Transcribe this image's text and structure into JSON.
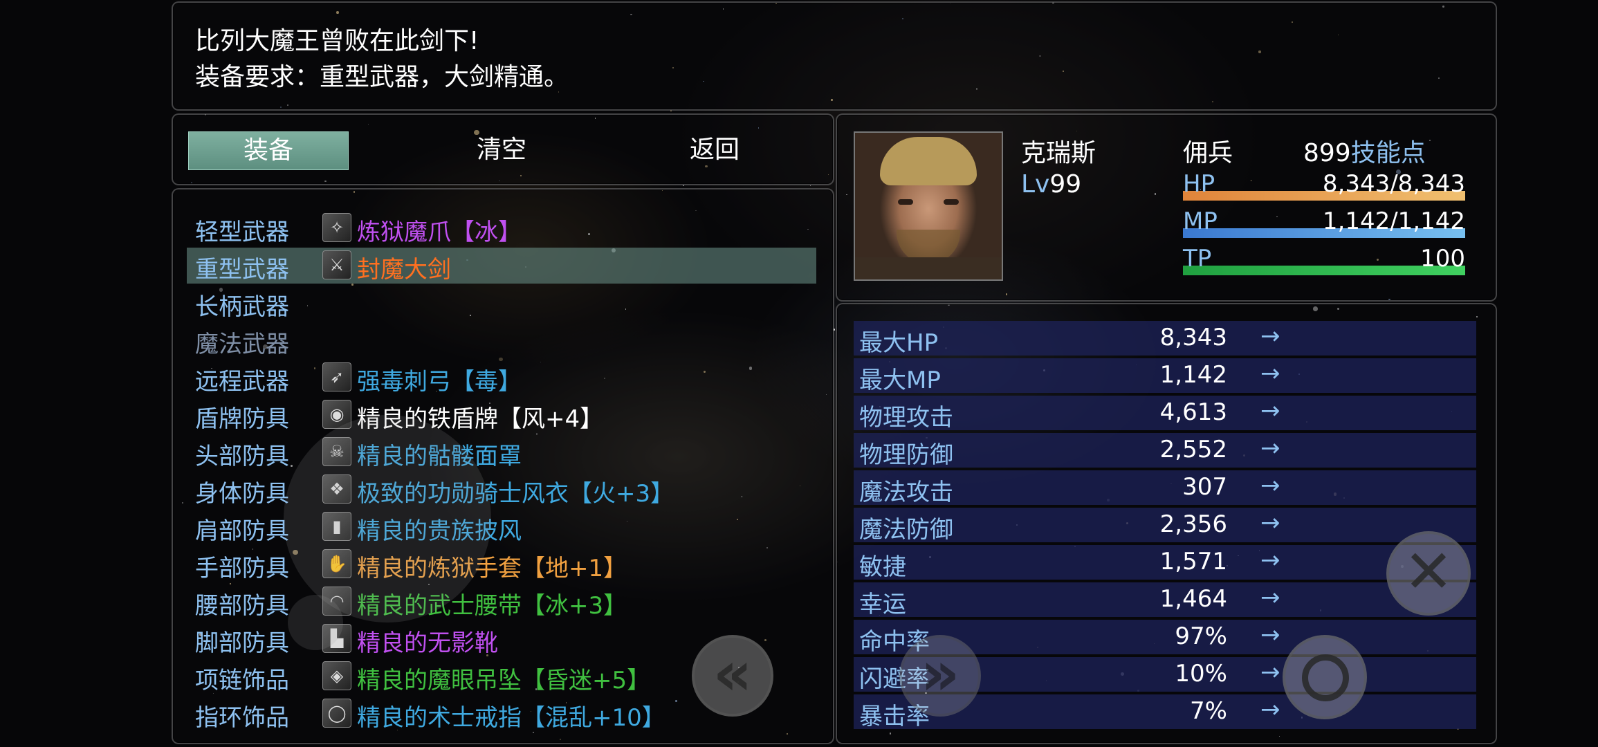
{
  "help": {
    "line1": "比列大魔王曾败在此剑下!",
    "line2": "装备要求：重型武器，大剑精通。"
  },
  "commands": [
    {
      "label": "装备",
      "selected": true
    },
    {
      "label": "清空",
      "selected": false
    },
    {
      "label": "返回",
      "selected": false
    }
  ],
  "slots": [
    {
      "slot": "轻型武器",
      "item": "炼狱魔爪【冰】",
      "color": "#c050f0",
      "icon": "claw-icon",
      "glyph": "✧",
      "enabled": true,
      "selected": false
    },
    {
      "slot": "重型武器",
      "item": "封魔大剑",
      "color": "#ff7020",
      "icon": "sword-icon",
      "glyph": "⚔",
      "enabled": true,
      "selected": true
    },
    {
      "slot": "长柄武器",
      "item": "",
      "color": "#ffffff",
      "icon": "",
      "glyph": "",
      "enabled": true,
      "selected": false
    },
    {
      "slot": "魔法武器",
      "item": "",
      "color": "#ffffff",
      "icon": "",
      "glyph": "",
      "enabled": false,
      "selected": false
    },
    {
      "slot": "远程武器",
      "item": "强毒刺弓【毒】",
      "color": "#3fa9e0",
      "icon": "bow-icon",
      "glyph": "➶",
      "enabled": true,
      "selected": false
    },
    {
      "slot": "盾牌防具",
      "item": "精良的铁盾牌【风+4】",
      "color": "#ffffff",
      "icon": "shield-icon",
      "glyph": "◉",
      "enabled": true,
      "selected": false
    },
    {
      "slot": "头部防具",
      "item": "精良的骷髅面罩",
      "color": "#3fa9e0",
      "icon": "skull-mask-icon",
      "glyph": "☠",
      "enabled": true,
      "selected": false
    },
    {
      "slot": "身体防具",
      "item": "极致的功勋骑士风衣【火+3】",
      "color": "#3fa9e0",
      "icon": "armor-icon",
      "glyph": "❖",
      "enabled": true,
      "selected": false
    },
    {
      "slot": "肩部防具",
      "item": "精良的贵族披风",
      "color": "#3fa9e0",
      "icon": "cloak-icon",
      "glyph": "▮",
      "enabled": true,
      "selected": false
    },
    {
      "slot": "手部防具",
      "item": "精良的炼狱手套【地+1】",
      "color": "#f0a040",
      "icon": "glove-icon",
      "glyph": "✋",
      "enabled": true,
      "selected": false
    },
    {
      "slot": "腰部防具",
      "item": "精良的武士腰带【冰+3】",
      "color": "#40c040",
      "icon": "belt-icon",
      "glyph": "◠",
      "enabled": true,
      "selected": false
    },
    {
      "slot": "脚部防具",
      "item": "精良的无影靴",
      "color": "#c050f0",
      "icon": "boots-icon",
      "glyph": "▙",
      "enabled": true,
      "selected": false
    },
    {
      "slot": "项链饰品",
      "item": "精良的魔眼吊坠【昏迷+5】",
      "color": "#40c040",
      "icon": "pendant-icon",
      "glyph": "◈",
      "enabled": true,
      "selected": false
    },
    {
      "slot": "指环饰品",
      "item": "精良的术士戒指【混乱+10】",
      "color": "#3fa9e0",
      "icon": "ring-icon",
      "glyph": "◯",
      "enabled": true,
      "selected": false
    }
  ],
  "actor": {
    "name": "克瑞斯",
    "class": "佣兵",
    "level_label": "Lv",
    "level": "99",
    "skill_points": "899",
    "skill_points_label": "技能点",
    "hp_label": "HP",
    "hp_value": "8,343/8,343",
    "hp_ratio": 1.0,
    "hp_color_a": "#e0843a",
    "hp_color_b": "#f0c070",
    "mp_label": "MP",
    "mp_value": "1,142/1,142",
    "mp_ratio": 1.0,
    "mp_color_a": "#3a78d0",
    "mp_color_b": "#78c0f0",
    "tp_label": "TP",
    "tp_value": "100",
    "tp_ratio": 1.0,
    "tp_color_a": "#20a040",
    "tp_color_b": "#40d060"
  },
  "params": [
    {
      "name": "最大HP",
      "value": "8,343",
      "arrow": "→"
    },
    {
      "name": "最大MP",
      "value": "1,142",
      "arrow": "→"
    },
    {
      "name": "物理攻击",
      "value": "4,613",
      "arrow": "→"
    },
    {
      "name": "物理防御",
      "value": "2,552",
      "arrow": "→"
    },
    {
      "name": "魔法攻击",
      "value": "307",
      "arrow": "→"
    },
    {
      "name": "魔法防御",
      "value": "2,356",
      "arrow": "→"
    },
    {
      "name": "敏捷",
      "value": "1,571",
      "arrow": "→"
    },
    {
      "name": "幸运",
      "value": "1,464",
      "arrow": "→"
    },
    {
      "name": "命中率",
      "value": "97%",
      "arrow": "→"
    },
    {
      "name": "闪避率",
      "value": "10%",
      "arrow": "→"
    },
    {
      "name": "暴击率",
      "value": "7%",
      "arrow": "→"
    }
  ],
  "touch_controls": {
    "page_prev_icon": "double-chevron-left-icon",
    "page_next_icon": "double-chevron-right-icon",
    "cancel_icon": "close-icon",
    "confirm_icon": "confirm-circle-icon"
  }
}
